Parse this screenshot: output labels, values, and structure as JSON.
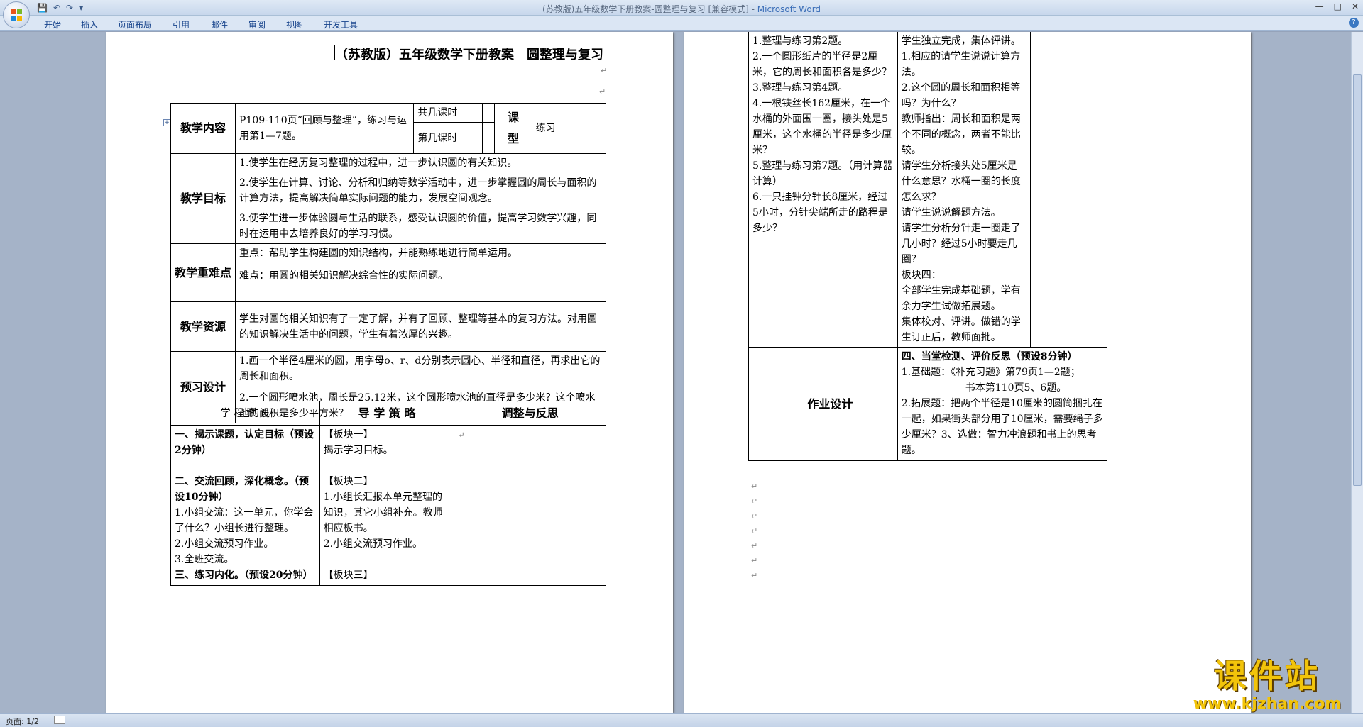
{
  "window": {
    "title": "(苏教版)五年级数学下册教案-圆整理与复习 [兼容模式] - ",
    "app_name": "Microsoft Word",
    "quick_access": [
      "💾",
      "↶",
      "↷",
      "▾"
    ]
  },
  "ribbon": {
    "tabs": [
      "开始",
      "插入",
      "页面布局",
      "引用",
      "邮件",
      "审阅",
      "视图",
      "开发工具"
    ]
  },
  "document": {
    "title": "（苏教版）五年级数学下册教案　圆整理与复习",
    "header_table": {
      "content_label": "教学内容",
      "content_value": "P109-110页“回顾与整理”，练习与运用第1—7题。",
      "total_hours_label": "共几课时",
      "which_hour_label": "第几课时",
      "lesson_type_label": "课　型",
      "lesson_type_value": "练习",
      "objectives_label": "教学目标",
      "objectives": [
        "1.使学生在经历复习整理的过程中，进一步认识圆的有关知识。",
        "2.使学生在计算、讨论、分析和归纳等数学活动中，进一步掌握圆的周长与面积的计算方法，提高解决简单实际问题的能力，发展空间观念。",
        "3.使学生进一步体验圆与生活的联系，感受认识圆的价值，提高学习数学兴趣，同时在运用中去培养良好的学习习惯。"
      ],
      "key_points_label": "教学重难点",
      "key_points": [
        "重点：帮助学生构建圆的知识结构，并能熟练地进行简单运用。",
        "难点：用圆的相关知识解决综合性的实际问题。"
      ],
      "resources_label": "教学资源",
      "resources": "学生对圆的相关知识有了一定了解，并有了回顾、整理等基本的复习方法。对用圆的知识解决生活中的问题，学生有着浓厚的兴趣。",
      "preview_label": "预习设计",
      "preview": [
        "1.画一个半径4厘米的圆，用字母o、r、d分别表示圆心、半径和直径，再求出它的周长和面积。",
        "2.一个圆形喷水池，周长是25.12米，这个圆形喷水池的直径是多少米？这个喷水池的面积是多少平方米？"
      ]
    },
    "process_table": {
      "col1_header": "学 程 预 设",
      "col2_header": "导 学 策 略",
      "col3_header": "调整与反思",
      "col1_lines": [
        "一、揭示课题，认定目标（预设2分钟）",
        "",
        "二、交流回顾，深化概念。（预设10分钟）",
        "1.小组交流：这一单元，你学会了什么？小组长进行整理。",
        "2.小组交流预习作业。",
        "3.全班交流。",
        "三、练习内化。（预设20分钟）"
      ],
      "col2_lines": [
        "【板块一】",
        "揭示学习目标。",
        "",
        "【板块二】",
        "1.小组长汇报本单元整理的知识，其它小组补充。教师相应板书。",
        "2.小组交流预习作业。",
        "",
        "【板块三】"
      ]
    },
    "page2": {
      "col1_lines": [
        "1.整理与练习第2题。",
        "2.一个圆形纸片的半径是2厘米，它的周长和面积各是多少？",
        "3.整理与练习第4题。",
        "4.一根铁丝长162厘米，在一个水桶的外面围一圈，接头处是5厘米，这个水桶的半径是多少厘米？",
        "5.整理与练习第7题。（用计算器计算）",
        "6.一只挂钟分针长8厘米，经过5小时，分针尖端所走的路程是多少？"
      ],
      "col2_lines": [
        "学生独立完成，集体评讲。",
        "1.相应的请学生说说计算方法。",
        "2.这个圆的周长和面积相等吗？为什么？",
        "教师指出：周长和面积是两个不同的概念，两者不能比较。",
        "请学生分析接头处5厘米是什么意思？水桶一圈的长度怎么求？",
        "请学生说说解题方法。",
        "请学生分析分针走一圈走了几小时？经过5小时要走几圈？",
        "板块四：",
        "全部学生完成基础题，学有余力学生试做拓展题。",
        "集体校对、评讲。做错的学生订正后，教师面批。"
      ],
      "homework_label": "作业设计",
      "homework_lines": [
        "四、当堂检测、评价反思（预设8分钟）",
        "1.基础题：《补充习题》第79页1—2题；",
        "书本第110页5、6题。",
        "2.拓展题：把两个半径是10厘米的圆筒捆扎在一起，如果街头部分用了10厘米，需要绳子多少厘米？3、选做：智力冲浪题和书上的思考题。"
      ]
    }
  },
  "status": {
    "page_indicator": "页面: 1/2"
  },
  "watermark": {
    "brand": "课件站",
    "url": "www.kjzhan.com"
  }
}
